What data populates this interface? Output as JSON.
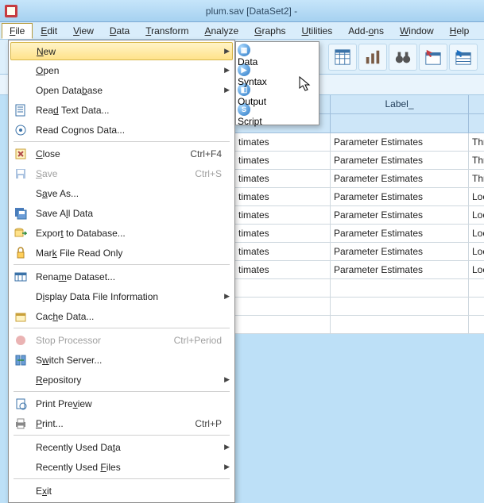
{
  "title": "plum.sav [DataSet2] -",
  "menubar": [
    "File",
    "Edit",
    "View",
    "Data",
    "Transform",
    "Analyze",
    "Graphs",
    "Utilities",
    "Add-ons",
    "Window",
    "Help"
  ],
  "file_menu": {
    "new": "New",
    "open": "Open",
    "open_db": "Open Database",
    "read_text": "Read Text Data...",
    "read_cognos": "Read Cognos Data...",
    "close": "Close",
    "close_sc": "Ctrl+F4",
    "save": "Save",
    "save_sc": "Ctrl+S",
    "save_as": "Save As...",
    "save_all": "Save All Data",
    "export_db": "Export to Database...",
    "mark_ro": "Mark File Read Only",
    "rename_ds": "Rename Dataset...",
    "display_info": "Display Data File Information",
    "cache": "Cache Data...",
    "stop_proc": "Stop Processor",
    "stop_proc_sc": "Ctrl+Period",
    "switch_srv": "Switch Server...",
    "repository": "Repository",
    "print_prev": "Print Preview",
    "print": "Print...",
    "print_sc": "Ctrl+P",
    "recent_data": "Recently Used Data",
    "recent_files": "Recently Used Files",
    "exit": "Exit"
  },
  "new_submenu": {
    "data": "Data",
    "syntax": "Syntax",
    "output": "Output",
    "script": "Script"
  },
  "grid": {
    "label_header": "Label_",
    "col_a": [
      "timates",
      "timates",
      "timates",
      "timates",
      "timates",
      "timates",
      "timates",
      "timates"
    ],
    "col_b": [
      "Parameter Estimates",
      "Parameter Estimates",
      "Parameter Estimates",
      "Parameter Estimates",
      "Parameter Estimates",
      "Parameter Estimates",
      "Parameter Estimates",
      "Parameter Estimates"
    ],
    "col_c": [
      "Thres",
      "Thres",
      "Thres",
      "Loca",
      "Loca",
      "Loca",
      "Loca",
      "Loca"
    ]
  }
}
